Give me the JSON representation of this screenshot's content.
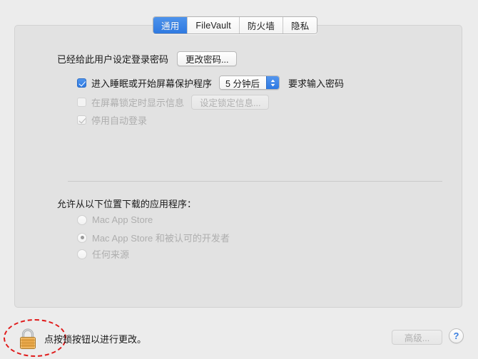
{
  "tabs": [
    {
      "label": "通用",
      "active": true
    },
    {
      "label": "FileVault",
      "active": false
    },
    {
      "label": "防火墙",
      "active": false
    },
    {
      "label": "隐私",
      "active": false
    }
  ],
  "login_section": {
    "password_status_label": "已经给此用户设定登录密码",
    "change_password_button": "更改密码...",
    "require_password": {
      "checkbox_label": "进入睡眠或开始屏幕保护程序",
      "checked": true,
      "delay_value": "5 分钟后",
      "trailing_label": "要求输入密码"
    },
    "lock_message": {
      "checkbox_label": "在屏幕锁定时显示信息",
      "checked": false,
      "button_label": "设定锁定信息..."
    },
    "disable_auto_login": {
      "checkbox_label": "停用自动登录",
      "checked": true
    }
  },
  "download_section": {
    "heading": "允许从以下位置下载的应用程序：",
    "options": [
      {
        "label": "Mac App Store",
        "selected": false
      },
      {
        "label": "Mac App Store 和被认可的开发者",
        "selected": true
      },
      {
        "label": "任何来源",
        "selected": false
      }
    ]
  },
  "bottom_bar": {
    "lock_icon": "padlock-locked-icon",
    "lock_message": "点按锁按钮以进行更改。",
    "advanced_button": "高级...",
    "help_button": "?"
  },
  "annotation": {
    "shape": "dashed-ellipse",
    "color": "#e01b1b",
    "target": "lock-button"
  },
  "colors": {
    "accent_blue": "#2d79e2",
    "panel_bg": "#e2e2e2",
    "window_bg": "#ececec",
    "disabled_text": "#aeaeae",
    "annotation_red": "#e01b1b"
  }
}
